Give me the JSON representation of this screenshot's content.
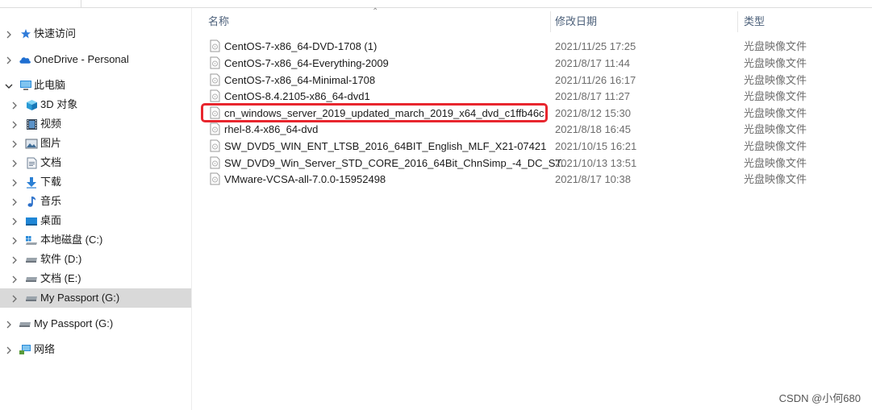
{
  "sidebar": {
    "items": [
      {
        "label": "快速访问",
        "icon": "star-icon",
        "selected": false
      },
      {
        "label": "OneDrive - Personal",
        "icon": "cloud-icon",
        "selected": false
      },
      {
        "label": "此电脑",
        "icon": "computer-icon",
        "selected": false
      },
      {
        "label": "3D 对象",
        "icon": "cube-icon",
        "selected": false
      },
      {
        "label": "视频",
        "icon": "film-icon",
        "selected": false
      },
      {
        "label": "图片",
        "icon": "image-icon",
        "selected": false
      },
      {
        "label": "文档",
        "icon": "document-icon",
        "selected": false
      },
      {
        "label": "下载",
        "icon": "download-arrow-icon",
        "selected": false
      },
      {
        "label": "音乐",
        "icon": "music-note-icon",
        "selected": false
      },
      {
        "label": "桌面",
        "icon": "desktop-icon",
        "selected": false
      },
      {
        "label": "本地磁盘 (C:)",
        "icon": "windows-drive-icon",
        "selected": false
      },
      {
        "label": "软件 (D:)",
        "icon": "drive-icon",
        "selected": false
      },
      {
        "label": "文档 (E:)",
        "icon": "drive-icon",
        "selected": false
      },
      {
        "label": "My Passport (G:)",
        "icon": "drive-icon",
        "selected": true
      },
      {
        "label": "My Passport (G:)",
        "icon": "drive-icon",
        "selected": false
      },
      {
        "label": "网络",
        "icon": "network-icon",
        "selected": false
      }
    ]
  },
  "columns": {
    "name": "名称",
    "date": "修改日期",
    "type": "类型"
  },
  "files": [
    {
      "name": "CentOS-7-x86_64-DVD-1708 (1)",
      "date": "2021/11/25 17:25",
      "type": "光盘映像文件"
    },
    {
      "name": "CentOS-7-x86_64-Everything-2009",
      "date": "2021/8/17 11:44",
      "type": "光盘映像文件"
    },
    {
      "name": "CentOS-7-x86_64-Minimal-1708",
      "date": "2021/11/26 16:17",
      "type": "光盘映像文件"
    },
    {
      "name": "CentOS-8.4.2105-x86_64-dvd1",
      "date": "2021/8/17 11:27",
      "type": "光盘映像文件"
    },
    {
      "name": "cn_windows_server_2019_updated_march_2019_x64_dvd_c1ffb46c",
      "date": "2021/8/12 15:30",
      "type": "光盘映像文件"
    },
    {
      "name": "rhel-8.4-x86_64-dvd",
      "date": "2021/8/18 16:45",
      "type": "光盘映像文件"
    },
    {
      "name": "SW_DVD5_WIN_ENT_LTSB_2016_64BIT_English_MLF_X21-07421",
      "date": "2021/10/15 16:21",
      "type": "光盘映像文件"
    },
    {
      "name": "SW_DVD9_Win_Server_STD_CORE_2016_64Bit_ChnSimp_-4_DC_ST...",
      "date": "2021/10/13 13:51",
      "type": "光盘映像文件"
    },
    {
      "name": "VMware-VCSA-all-7.0.0-15952498",
      "date": "2021/8/17 10:38",
      "type": "光盘映像文件"
    }
  ],
  "watermark": "CSDN @小何680",
  "colors": {
    "selected": "#d9d9d9",
    "highlight": "#e8262e",
    "header": "#4c607a"
  }
}
